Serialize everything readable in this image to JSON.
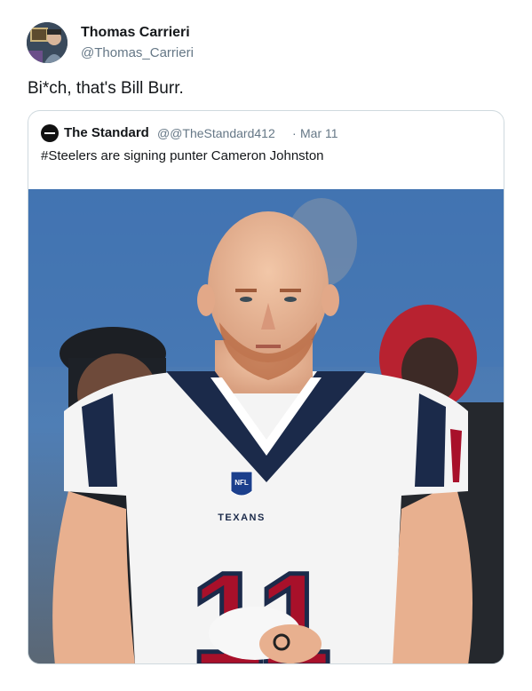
{
  "tweet": {
    "author_name": "Thomas Carrieri",
    "author_handle": "@Thomas_Carrieri",
    "text": "Bi*ch, that's Bill Burr."
  },
  "quoted_tweet": {
    "author_name": "The Standard",
    "author_handle": "@@TheStandard412",
    "separator": "·",
    "date": "Mar 11",
    "text": "#Steelers are signing punter Cameron Johnston",
    "photo": {
      "jersey_team": "TEXANS",
      "jersey_number": "11",
      "shield_text": "NFL"
    }
  },
  "colors": {
    "text_primary": "#14171a",
    "text_secondary": "#657786",
    "card_border": "#cfd9de",
    "jersey_navy": "#1b2a4a",
    "jersey_red": "#a8102a"
  }
}
